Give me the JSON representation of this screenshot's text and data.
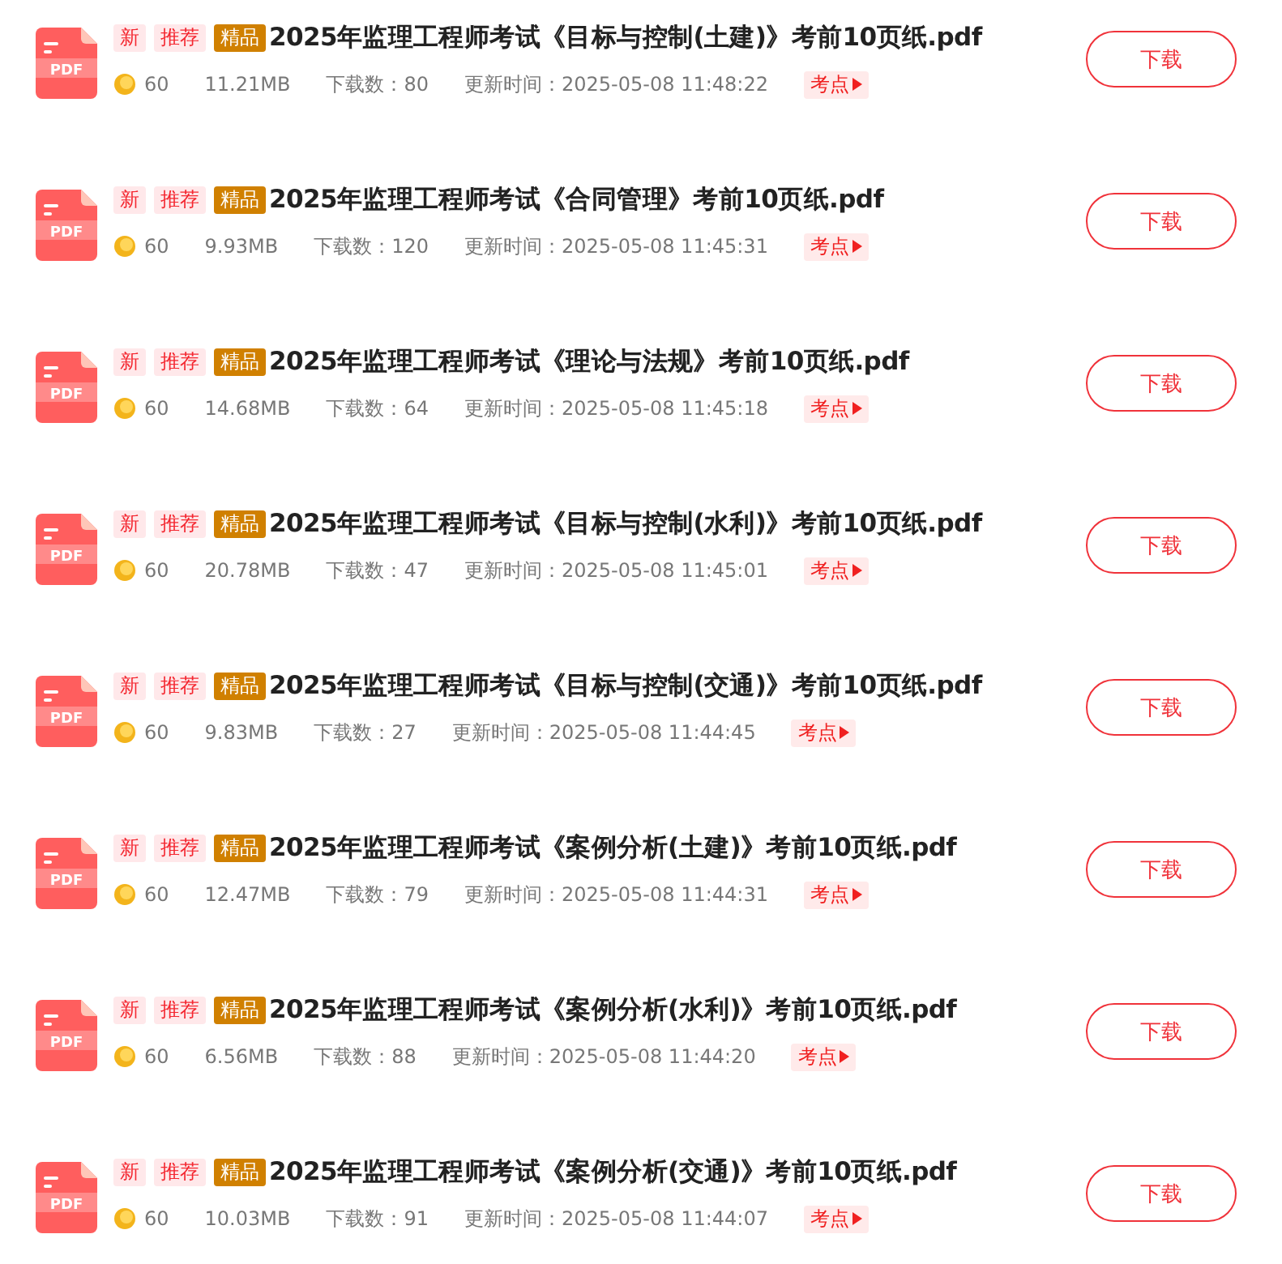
{
  "files": [
    {
      "badges": [
        {
          "label": "新",
          "kind": "new"
        },
        {
          "label": "推荐",
          "kind": "recommend"
        },
        {
          "label": "精品",
          "kind": "premium"
        }
      ],
      "icon_label": "PDF",
      "title": "2025年监理工程师考试《目标与控制(土建)》考前10页纸.pdf",
      "coins": "60",
      "size": "11.21MB",
      "downloads": "下载数：80",
      "updated": "更新时间：2025-05-08 11:48:22",
      "tag": "考点",
      "button": "下载"
    },
    {
      "badges": [
        {
          "label": "新",
          "kind": "new"
        },
        {
          "label": "推荐",
          "kind": "recommend"
        },
        {
          "label": "精品",
          "kind": "premium"
        }
      ],
      "icon_label": "PDF",
      "title": "2025年监理工程师考试《合同管理》考前10页纸.pdf",
      "coins": "60",
      "size": "9.93MB",
      "downloads": "下载数：120",
      "updated": "更新时间：2025-05-08 11:45:31",
      "tag": "考点",
      "button": "下载"
    },
    {
      "badges": [
        {
          "label": "新",
          "kind": "new"
        },
        {
          "label": "推荐",
          "kind": "recommend"
        },
        {
          "label": "精品",
          "kind": "premium"
        }
      ],
      "icon_label": "PDF",
      "title": "2025年监理工程师考试《理论与法规》考前10页纸.pdf",
      "coins": "60",
      "size": "14.68MB",
      "downloads": "下载数：64",
      "updated": "更新时间：2025-05-08 11:45:18",
      "tag": "考点",
      "button": "下载"
    },
    {
      "badges": [
        {
          "label": "新",
          "kind": "new"
        },
        {
          "label": "推荐",
          "kind": "recommend"
        },
        {
          "label": "精品",
          "kind": "premium"
        }
      ],
      "icon_label": "PDF",
      "title": "2025年监理工程师考试《目标与控制(水利)》考前10页纸.pdf",
      "coins": "60",
      "size": "20.78MB",
      "downloads": "下载数：47",
      "updated": "更新时间：2025-05-08 11:45:01",
      "tag": "考点",
      "button": "下载"
    },
    {
      "badges": [
        {
          "label": "新",
          "kind": "new"
        },
        {
          "label": "推荐",
          "kind": "recommend"
        },
        {
          "label": "精品",
          "kind": "premium"
        }
      ],
      "icon_label": "PDF",
      "title": "2025年监理工程师考试《目标与控制(交通)》考前10页纸.pdf",
      "coins": "60",
      "size": "9.83MB",
      "downloads": "下载数：27",
      "updated": "更新时间：2025-05-08 11:44:45",
      "tag": "考点",
      "button": "下载"
    },
    {
      "badges": [
        {
          "label": "新",
          "kind": "new"
        },
        {
          "label": "推荐",
          "kind": "recommend"
        },
        {
          "label": "精品",
          "kind": "premium"
        }
      ],
      "icon_label": "PDF",
      "title": "2025年监理工程师考试《案例分析(土建)》考前10页纸.pdf",
      "coins": "60",
      "size": "12.47MB",
      "downloads": "下载数：79",
      "updated": "更新时间：2025-05-08 11:44:31",
      "tag": "考点",
      "button": "下载"
    },
    {
      "badges": [
        {
          "label": "新",
          "kind": "new"
        },
        {
          "label": "推荐",
          "kind": "recommend"
        },
        {
          "label": "精品",
          "kind": "premium"
        }
      ],
      "icon_label": "PDF",
      "title": "2025年监理工程师考试《案例分析(水利)》考前10页纸.pdf",
      "coins": "60",
      "size": "6.56MB",
      "downloads": "下载数：88",
      "updated": "更新时间：2025-05-08 11:44:20",
      "tag": "考点",
      "button": "下载"
    },
    {
      "badges": [
        {
          "label": "新",
          "kind": "new"
        },
        {
          "label": "推荐",
          "kind": "recommend"
        },
        {
          "label": "精品",
          "kind": "premium"
        }
      ],
      "icon_label": "PDF",
      "title": "2025年监理工程师考试《案例分析(交通)》考前10页纸.pdf",
      "coins": "60",
      "size": "10.03MB",
      "downloads": "下载数：91",
      "updated": "更新时间：2025-05-08 11:44:07",
      "tag": "考点",
      "button": "下载"
    }
  ]
}
